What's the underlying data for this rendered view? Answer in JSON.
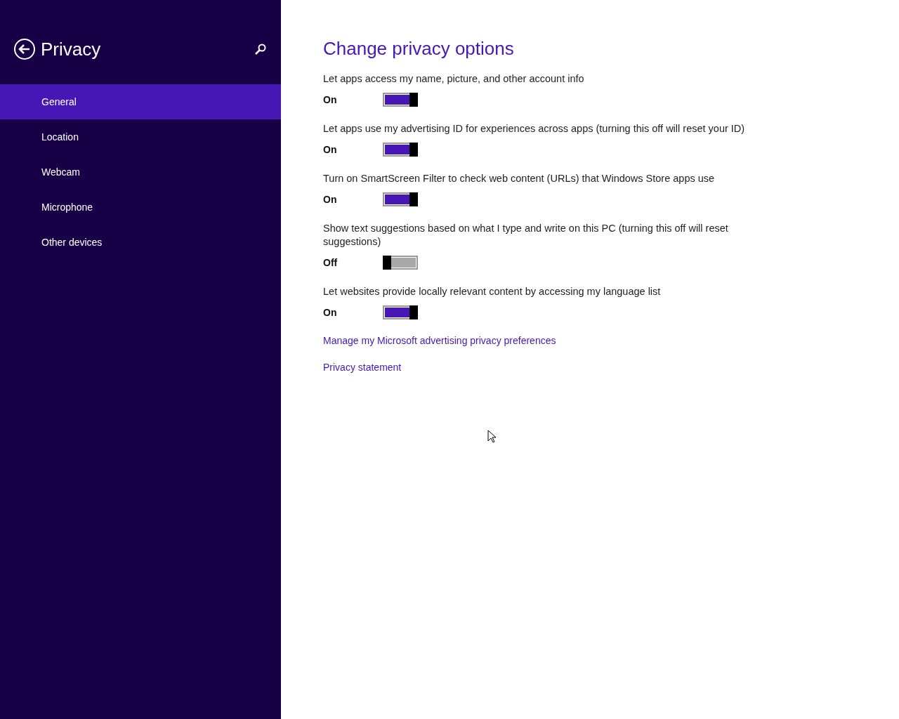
{
  "sidebar": {
    "title": "Privacy",
    "items": [
      {
        "label": "General",
        "selected": true
      },
      {
        "label": "Location",
        "selected": false
      },
      {
        "label": "Webcam",
        "selected": false
      },
      {
        "label": "Microphone",
        "selected": false
      },
      {
        "label": "Other devices",
        "selected": false
      }
    ]
  },
  "content": {
    "title": "Change privacy options",
    "settings": [
      {
        "label": "Let apps access my name, picture, and other account info",
        "state": "On",
        "on": true
      },
      {
        "label": "Let apps use my advertising ID for experiences across apps (turning this off will reset your ID)",
        "state": "On",
        "on": true
      },
      {
        "label": "Turn on SmartScreen Filter to check web content (URLs) that Windows Store apps use",
        "state": "On",
        "on": true
      },
      {
        "label": "Show text suggestions based on what I type and write on this PC (turning this off will reset suggestions)",
        "state": "Off",
        "on": false
      },
      {
        "label": "Let websites provide locally relevant content by accessing my language list",
        "state": "On",
        "on": true
      }
    ],
    "links": [
      "Manage my Microsoft advertising privacy preferences",
      "Privacy statement"
    ]
  }
}
